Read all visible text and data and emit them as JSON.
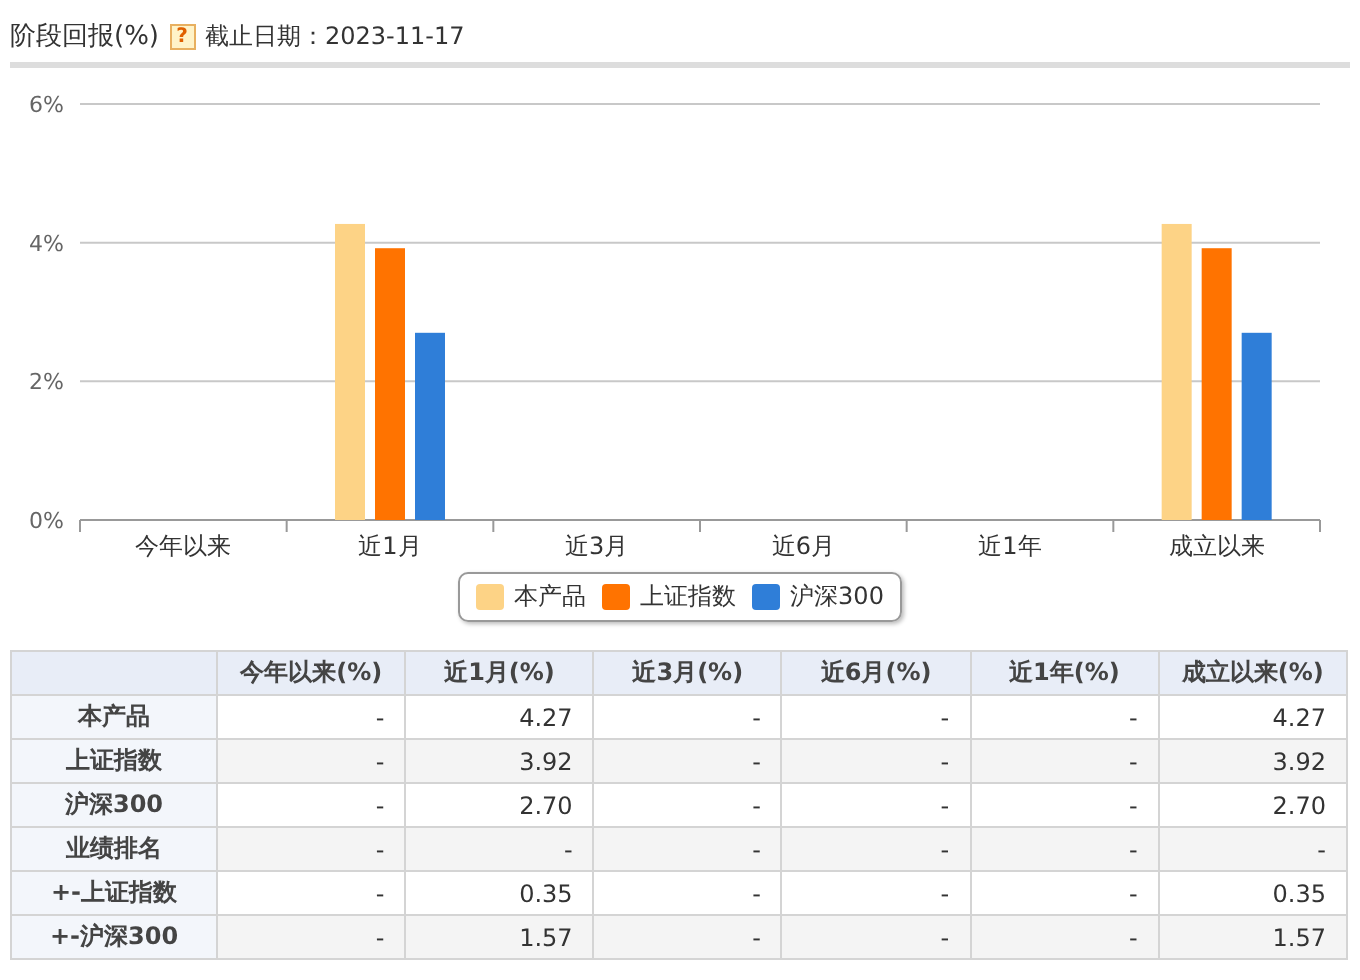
{
  "header": {
    "title": "阶段回报(%)",
    "help_icon": "?",
    "date_label": "截止日期：2023-11-17"
  },
  "chart": {
    "chart_data": {
      "type": "bar",
      "categories": [
        "今年以来",
        "近1月",
        "近3月",
        "近6月",
        "近1年",
        "成立以来"
      ],
      "legend": "bottom",
      "ylim": [
        0,
        6
      ],
      "yticks": [
        {
          "value": 0,
          "label": "0%"
        },
        {
          "value": 2,
          "label": "2%"
        },
        {
          "value": 4,
          "label": "4%"
        },
        {
          "value": 6,
          "label": "6%"
        }
      ],
      "series": [
        {
          "name": "本产品",
          "color": "#fdd386",
          "values": [
            null,
            4.27,
            null,
            null,
            null,
            4.27
          ]
        },
        {
          "name": "上证指数",
          "color": "#ff7300",
          "values": [
            null,
            3.92,
            null,
            null,
            null,
            3.92
          ]
        },
        {
          "name": "沪深300",
          "color": "#2f7ed8",
          "values": [
            null,
            2.7,
            null,
            null,
            null,
            2.7
          ]
        }
      ]
    }
  },
  "table": {
    "columns": [
      "今年以来(%)",
      "近1月(%)",
      "近3月(%)",
      "近6月(%)",
      "近1年(%)",
      "成立以来(%)"
    ],
    "rows": [
      {
        "label": "本产品",
        "cells": [
          "-",
          "4.27",
          "-",
          "-",
          "-",
          "4.27"
        ]
      },
      {
        "label": "上证指数",
        "cells": [
          "-",
          "3.92",
          "-",
          "-",
          "-",
          "3.92"
        ]
      },
      {
        "label": "沪深300",
        "cells": [
          "-",
          "2.70",
          "-",
          "-",
          "-",
          "2.70"
        ]
      },
      {
        "label": "业绩排名",
        "cells": [
          "-",
          "-",
          "-",
          "-",
          "-",
          "-"
        ]
      },
      {
        "label": "+-上证指数",
        "cells": [
          "-",
          "0.35",
          "-",
          "-",
          "-",
          "0.35"
        ]
      },
      {
        "label": "+-沪深300",
        "cells": [
          "-",
          "1.57",
          "-",
          "-",
          "-",
          "1.57"
        ]
      }
    ]
  }
}
